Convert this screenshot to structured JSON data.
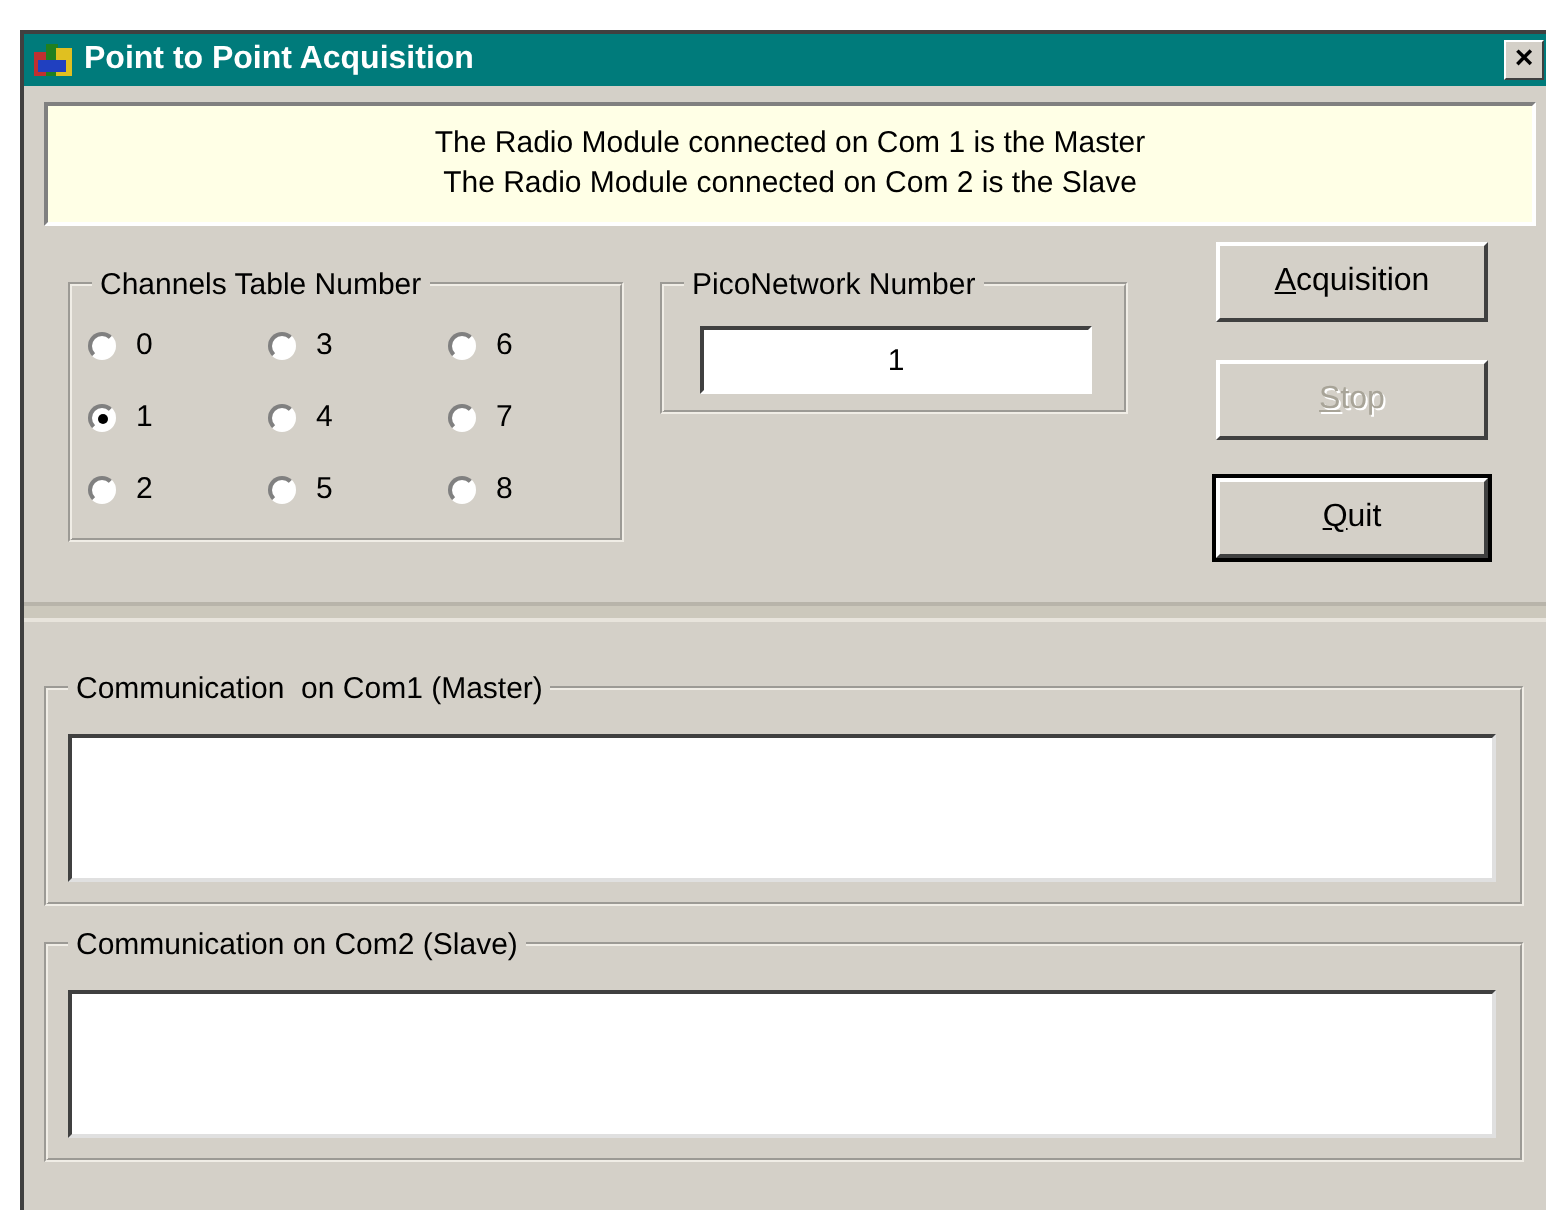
{
  "window": {
    "title": "Point to Point Acquisition",
    "close": "×"
  },
  "info": [
    "The Radio Module connected on Com 1 is the Master",
    "The Radio Module connected on Com 2 is the Slave"
  ],
  "channels_group": {
    "title": "Channels Table Number",
    "options": [
      {
        "label": "0",
        "selected": false
      },
      {
        "label": "1",
        "selected": true
      },
      {
        "label": "2",
        "selected": false
      },
      {
        "label": "3",
        "selected": false
      },
      {
        "label": "4",
        "selected": false
      },
      {
        "label": "5",
        "selected": false
      },
      {
        "label": "6",
        "selected": false
      },
      {
        "label": "7",
        "selected": false
      },
      {
        "label": "8",
        "selected": false
      }
    ]
  },
  "pico_group": {
    "title": "PicoNetwork Number",
    "value": "1"
  },
  "buttons": [
    {
      "label": "Acquisition",
      "disabled": false,
      "default": false,
      "mnemonic": true
    },
    {
      "label": "Stop",
      "disabled": true,
      "default": false,
      "mnemonic": true
    },
    {
      "label": "Quit",
      "disabled": false,
      "default": true,
      "mnemonic": true
    }
  ],
  "communication": [
    {
      "title": "Communication  on Com1 (Master)"
    },
    {
      "title": "Communication on Com2 (Slave)"
    }
  ]
}
